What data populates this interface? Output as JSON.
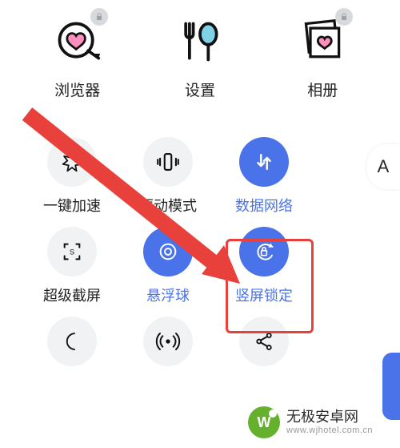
{
  "colors": {
    "accent": "#4a73ea",
    "highlight": "#e8403b",
    "icon_off_bg": "#f1f2f4",
    "lock_bg": "#d7d9dc"
  },
  "apps": [
    {
      "label": "浏览器",
      "icon": "browser-heart-icon",
      "locked": true
    },
    {
      "label": "设置",
      "icon": "settings-utensils-icon",
      "locked": false
    },
    {
      "label": "相册",
      "icon": "gallery-icon",
      "locked": true
    }
  ],
  "quick_settings": [
    {
      "label": "一键加速",
      "icon": "speed-boost-icon",
      "on": false
    },
    {
      "label": "振动模式",
      "icon": "vibrate-icon",
      "on": false
    },
    {
      "label": "数据网络",
      "icon": "data-network-icon",
      "on": true
    },
    {
      "label": "超级截屏",
      "icon": "super-screenshot-icon",
      "on": false
    },
    {
      "label": "悬浮球",
      "icon": "assistive-ball-icon",
      "on": true
    },
    {
      "label": "竖屏锁定",
      "icon": "portrait-lock-icon",
      "on": true
    },
    {
      "label": "",
      "icon": "moon-dnd-icon",
      "on": false
    },
    {
      "label": "",
      "icon": "hotspot-icon",
      "on": false
    },
    {
      "label": "",
      "icon": "share-icon",
      "on": false
    }
  ],
  "side_button": {
    "label": "A"
  },
  "watermark": {
    "line1": "无极安卓网",
    "line2": "www.wjhotel.com.cn",
    "logo_text": "W"
  },
  "annotation": {
    "highlighted_item_index": 5
  }
}
